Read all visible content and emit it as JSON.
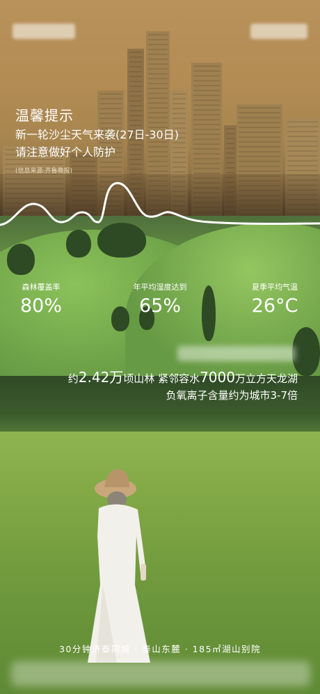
{
  "notice": {
    "title": "温馨提示",
    "line1": "新一轮沙尘天气来袭(27日-30日)",
    "line2": "请注意做好个人防护",
    "source": "(信息来源:齐鲁晚报)"
  },
  "stats": [
    {
      "label": "森林覆盖率",
      "value": "80%"
    },
    {
      "label": "年平均湿度达到",
      "value": "65%"
    },
    {
      "label": "夏季平均气温",
      "value": "26°C"
    }
  ],
  "captions": {
    "line1_prefix": "约",
    "line1_number": "2.42万",
    "line1_middle": "顷山林 紧邻容水",
    "line1_number2": "7000",
    "line1_suffix": "万立方天龙湖",
    "line2": "负氧离子含量约为城市3-7倍"
  },
  "footer": {
    "text": "30分钟济泰同城 · 泰山东麓 · 185㎡湖山别院"
  },
  "colors": {
    "dust": "#b38c54",
    "grass": "#7fb04e",
    "text": "#ffffff"
  }
}
